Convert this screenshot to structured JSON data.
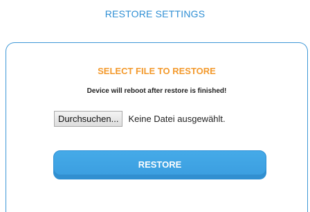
{
  "header": {
    "title": "RESTORE SETTINGS"
  },
  "restore_panel": {
    "section_title": "SELECT FILE TO RESTORE",
    "warning": "Device will reboot after restore is finished!",
    "file_input": {
      "button_label": "Durchsuchen...",
      "status": "Keine Datei ausgewählt."
    },
    "restore_button_label": "RESTORE"
  },
  "colors": {
    "accent_blue": "#2f8fd4",
    "accent_orange": "#f39a2d",
    "button_blue": "#3fa3e3"
  }
}
